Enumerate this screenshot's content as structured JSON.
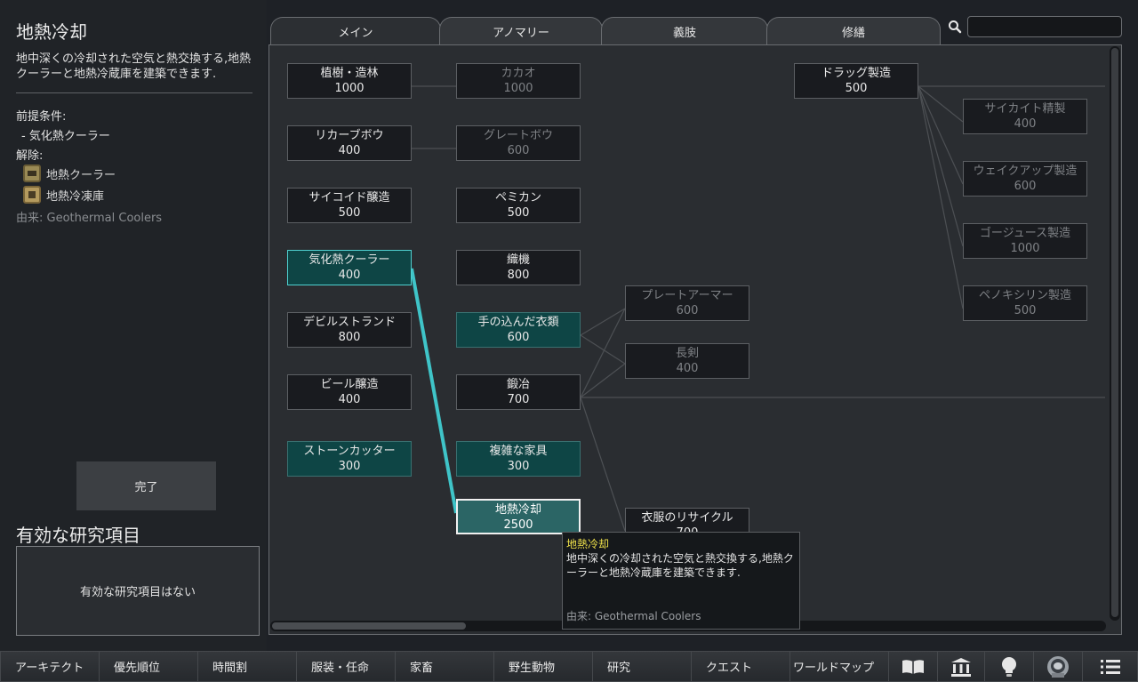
{
  "left": {
    "title": "地熱冷却",
    "description": "地中深くの冷却された空気と熱交換する,地熱クーラーと地熱冷蔵庫を建築できます.",
    "prereq_label": "前提条件:",
    "prereq_item": "- 気化熱クーラー",
    "unlock_label": "解除:",
    "unlocks": [
      "地熱クーラー",
      "地熱冷凍庫"
    ],
    "source": "由来:  Geothermal Coolers",
    "done_button": "完了",
    "active_title": "有効な研究項目",
    "active_empty": "有効な研究項目はない"
  },
  "tabs": [
    "メイン",
    "アノマリー",
    "義肢",
    "修繕"
  ],
  "search": {
    "value": ""
  },
  "nodes": {
    "n1": {
      "name": "植樹・造林",
      "cost": "1000"
    },
    "n2": {
      "name": "リカーブボウ",
      "cost": "400"
    },
    "n3": {
      "name": "サイコイド醸造",
      "cost": "500"
    },
    "n4": {
      "name": "気化熱クーラー",
      "cost": "400"
    },
    "n5": {
      "name": "デビルストランド",
      "cost": "800"
    },
    "n6": {
      "name": "ビール醸造",
      "cost": "400"
    },
    "n7": {
      "name": "ストーンカッター",
      "cost": "300"
    },
    "n8": {
      "name": "カカオ",
      "cost": "1000"
    },
    "n9": {
      "name": "グレートボウ",
      "cost": "600"
    },
    "n10": {
      "name": "ペミカン",
      "cost": "500"
    },
    "n11": {
      "name": "織機",
      "cost": "800"
    },
    "n12": {
      "name": "手の込んだ衣類",
      "cost": "600"
    },
    "n13": {
      "name": "鍛冶",
      "cost": "700"
    },
    "n14": {
      "name": "複雑な家具",
      "cost": "300"
    },
    "n15": {
      "name": "地熱冷却",
      "cost": "2500"
    },
    "n16": {
      "name": "プレートアーマー",
      "cost": "600"
    },
    "n17": {
      "name": "長剣",
      "cost": "400"
    },
    "n18": {
      "name": "衣服のリサイクル",
      "cost": "700"
    },
    "n19": {
      "name": "ドラッグ製造",
      "cost": "500"
    },
    "n20": {
      "name": "サイカイト精製",
      "cost": "400"
    },
    "n21": {
      "name": "ウェイクアップ製造",
      "cost": "600"
    },
    "n22": {
      "name": "ゴージュース製造",
      "cost": "1000"
    },
    "n23": {
      "name": "ペノキシリン製造",
      "cost": "500"
    }
  },
  "tooltip": {
    "title": "地熱冷却",
    "body": "地中深くの冷却された空気と熱交換する,地熱クーラーと地熱冷蔵庫を建築できます.",
    "source": "由来: Geothermal Coolers"
  },
  "bottom": [
    "アーキテクト",
    "優先順位",
    "時間割",
    "服装・任命",
    "家畜",
    "野生動物",
    "研究",
    "クエスト",
    "ワールドマップ"
  ],
  "bottom_icons": [
    "book-icon",
    "museum-icon",
    "lightbulb-icon",
    "astronaut-icon",
    "menu-icon"
  ],
  "colors": {
    "available": "#0e4545",
    "selected_link": "#3fc4c8",
    "tooltip_title": "#f0e24a"
  }
}
